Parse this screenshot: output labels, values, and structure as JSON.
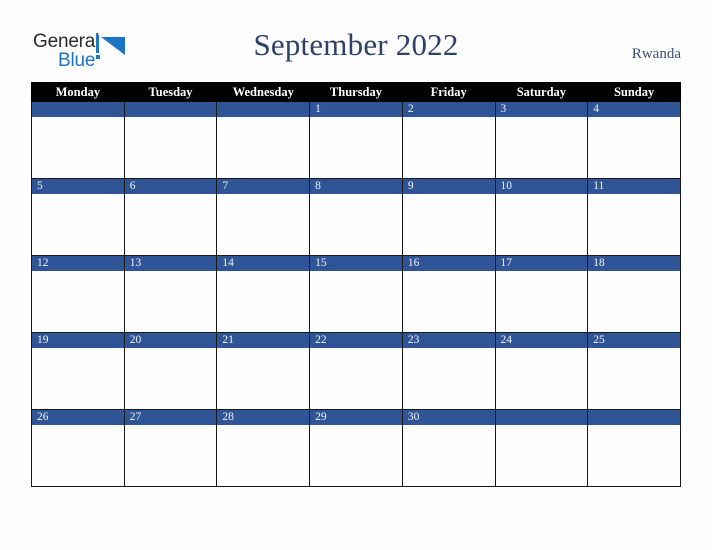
{
  "brand": {
    "name_top": "General",
    "name_bottom": "Blue",
    "mark_icon": "triangle-logo-icon",
    "color_top": "#2b2b2b",
    "color_bottom": "#1b74c4"
  },
  "header": {
    "title": "September 2022",
    "country": "Rwanda",
    "title_color": "#2d4169",
    "country_color": "#3c4f78"
  },
  "calendar": {
    "weekday_headers": [
      "Monday",
      "Tuesday",
      "Wednesday",
      "Thursday",
      "Friday",
      "Saturday",
      "Sunday"
    ],
    "header_bg": "#000000",
    "header_text_color": "#ffffff",
    "date_bar_color": "#2f5597",
    "date_text_color": "#f0f2f7",
    "cell_bg": "#fdfdfd",
    "border_color": "#1a1a1a",
    "weeks": [
      [
        "",
        "",
        "",
        "1",
        "2",
        "3",
        "4"
      ],
      [
        "5",
        "6",
        "7",
        "8",
        "9",
        "10",
        "11"
      ],
      [
        "12",
        "13",
        "14",
        "15",
        "16",
        "17",
        "18"
      ],
      [
        "19",
        "20",
        "21",
        "22",
        "23",
        "24",
        "25"
      ],
      [
        "26",
        "27",
        "28",
        "29",
        "30",
        "",
        ""
      ]
    ]
  }
}
